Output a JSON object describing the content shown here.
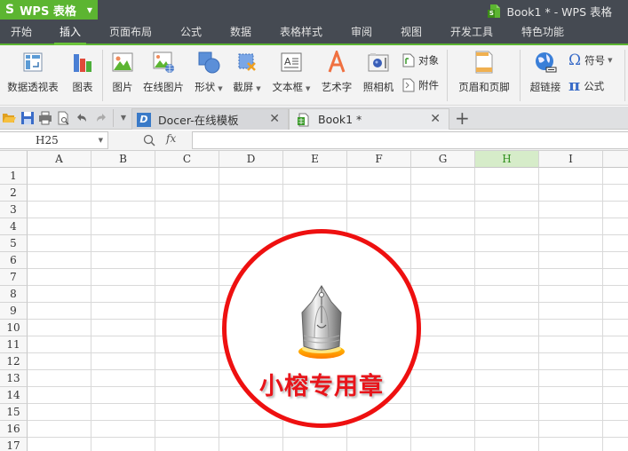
{
  "app": {
    "menu_button": "WPS 表格",
    "window_title": "Book1 * - WPS 表格"
  },
  "menu_tabs": [
    {
      "label": "开始",
      "active": false
    },
    {
      "label": "插入",
      "active": true
    },
    {
      "label": "页面布局",
      "active": false
    },
    {
      "label": "公式",
      "active": false
    },
    {
      "label": "数据",
      "active": false
    },
    {
      "label": "表格样式",
      "active": false
    },
    {
      "label": "审阅",
      "active": false
    },
    {
      "label": "视图",
      "active": false
    },
    {
      "label": "开发工具",
      "active": false
    },
    {
      "label": "特色功能",
      "active": false
    }
  ],
  "ribbon": {
    "pivot_table": "数据透视表",
    "chart": "图表",
    "picture": "图片",
    "online_picture": "在线图片",
    "shapes": "形状",
    "screenshot": "截屏",
    "textbox": "文本框",
    "wordart": "艺术字",
    "camera": "照相机",
    "object": "对象",
    "attachment": "附件",
    "header_footer": "页眉和页脚",
    "hyperlink": "超链接",
    "symbol": "符号",
    "equation": "公式"
  },
  "doc_tabs": [
    {
      "label": "Docer-在线模板",
      "active": false
    },
    {
      "label": "Book1 *",
      "active": true
    }
  ],
  "formula_bar": {
    "name_box": "H25",
    "fx_label": "fx",
    "formula": ""
  },
  "sheet": {
    "columns": [
      "A",
      "B",
      "C",
      "D",
      "E",
      "F",
      "G",
      "H",
      "I"
    ],
    "selected_column": "H",
    "rows": [
      "1",
      "2",
      "3",
      "4",
      "5",
      "6",
      "7",
      "8",
      "9",
      "10",
      "11",
      "12",
      "13",
      "14",
      "15",
      "16",
      "17"
    ]
  },
  "stamp": {
    "text": "小榕专用章",
    "ring_color": "#ee1010",
    "text_color": "#e8141a"
  },
  "colors": {
    "accent_green": "#5cb531",
    "titlebar": "#454a52",
    "selected_header": "#d6ecc9"
  }
}
